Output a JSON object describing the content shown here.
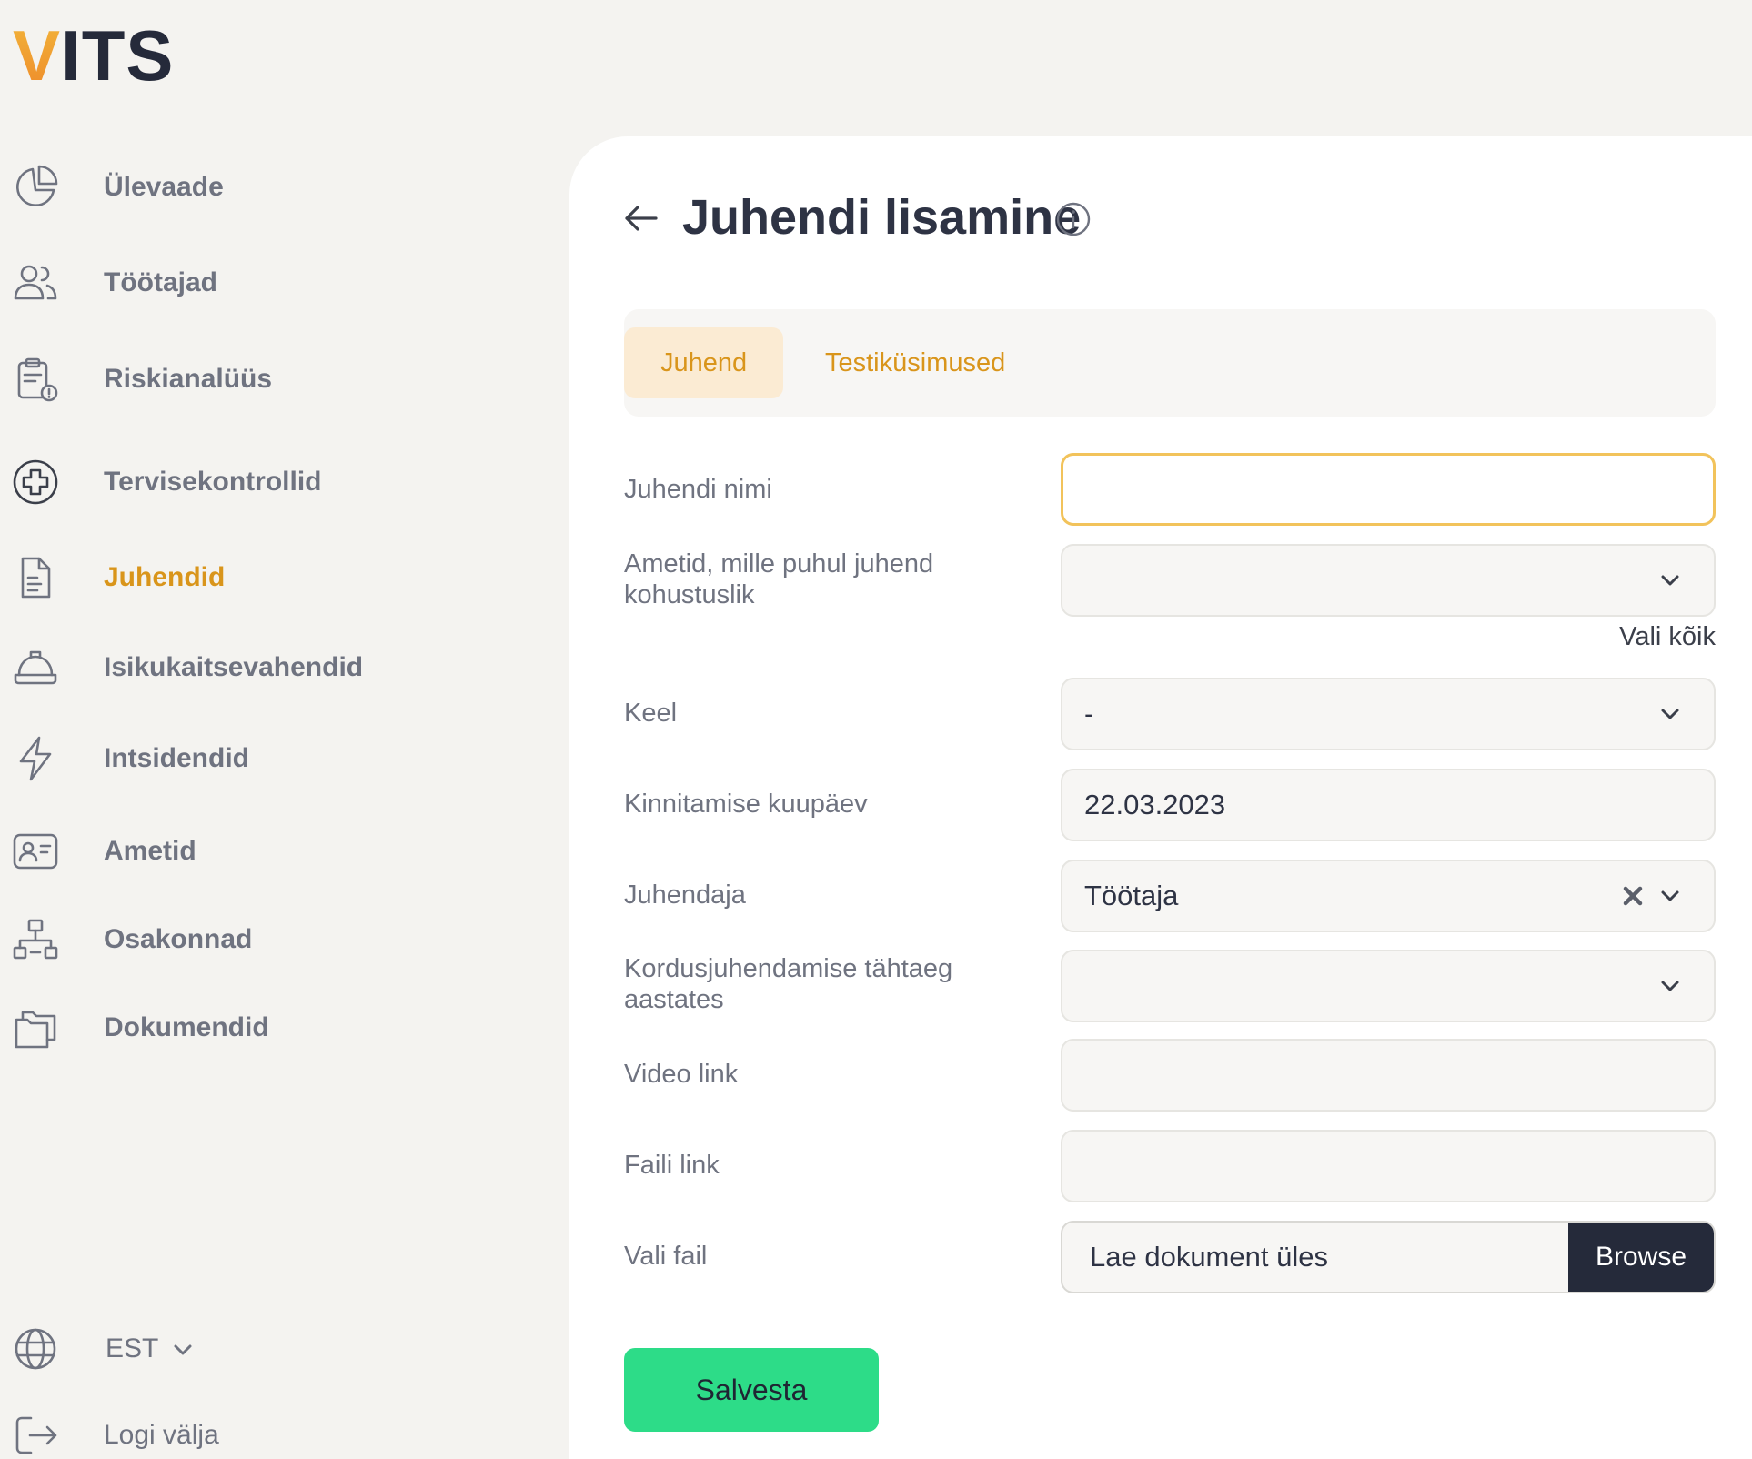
{
  "logo": {
    "first": "V",
    "rest": "ITS"
  },
  "sidebar": {
    "items": [
      {
        "label": "Ülevaade",
        "icon": "chart-pie-icon"
      },
      {
        "label": "Töötajad",
        "icon": "users-icon"
      },
      {
        "label": "Riskianalüüs",
        "icon": "clipboard-alert-icon"
      },
      {
        "label": "Tervisekontrollid",
        "icon": "medical-cross-icon"
      },
      {
        "label": "Juhendid",
        "icon": "document-icon",
        "active": true
      },
      {
        "label": "Isikukaitsevahendid",
        "icon": "hard-hat-icon"
      },
      {
        "label": "Intsidendid",
        "icon": "lightning-icon"
      },
      {
        "label": "Ametid",
        "icon": "id-card-icon"
      },
      {
        "label": "Osakonnad",
        "icon": "org-chart-icon"
      },
      {
        "label": "Dokumendid",
        "icon": "folders-icon"
      }
    ],
    "language": "EST",
    "logout": "Logi välja"
  },
  "header": {
    "title": "Juhendi lisamine"
  },
  "tabs": [
    {
      "label": "Juhend",
      "active": true
    },
    {
      "label": "Testiküsimused",
      "active": false
    }
  ],
  "form": {
    "name_label": "Juhendi nimi",
    "name_value": "",
    "positions_label": "Ametid, mille puhul juhend kohustuslik",
    "positions_value": "",
    "select_all": "Vali kõik",
    "language_label": "Keel",
    "language_value": "-",
    "date_label": "Kinnitamise kuupäev",
    "date_value": "22.03.2023",
    "instructor_label": "Juhendaja",
    "instructor_value": "Töötaja",
    "repeat_label": "Kordusjuhendamise tähtaeg aastates",
    "repeat_value": "",
    "video_label": "Video link",
    "video_value": "",
    "file_link_label": "Faili link",
    "file_link_value": "",
    "file_label": "Vali fail",
    "file_placeholder": "Lae dokument üles",
    "browse": "Browse",
    "save": "Salvesta"
  },
  "colors": {
    "accent": "#d9951b",
    "tab_active_bg": "#fbebd3",
    "save_button": "#2ddc88",
    "dark": "#252a3a",
    "focus_border": "#f2c35b"
  }
}
